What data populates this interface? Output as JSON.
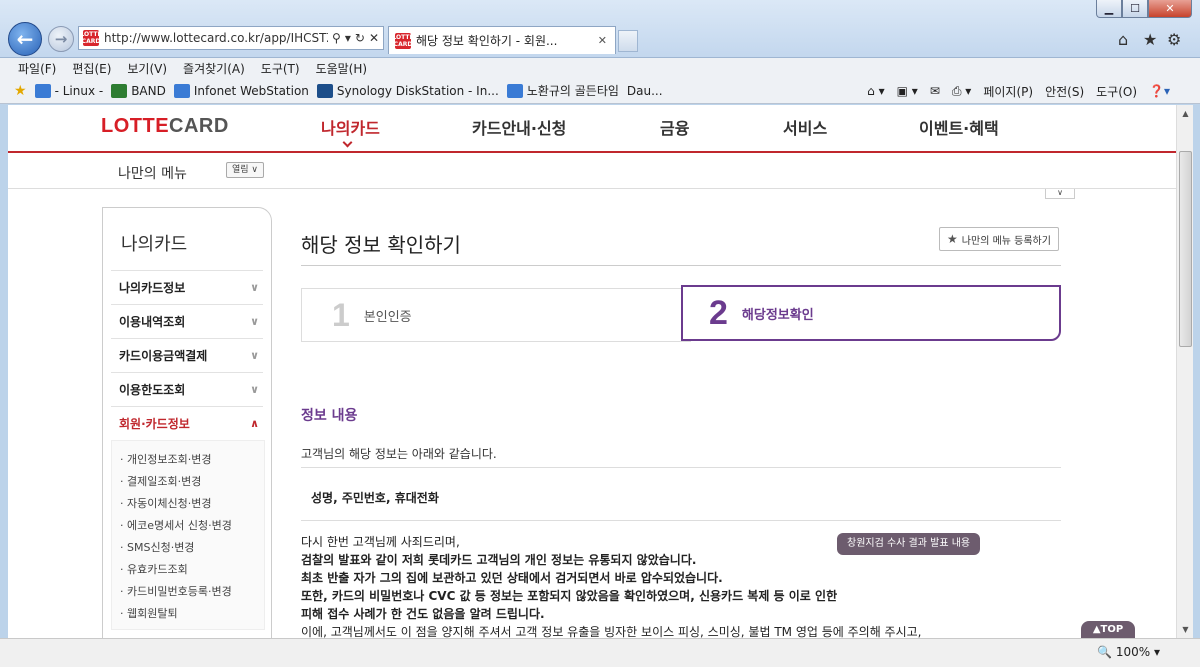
{
  "browser": {
    "address_url": "http://www.lottecard.co.kr/app/IHCSTZ",
    "tab_title": "해당 정보 확인하기 - 회원...",
    "favicon_text": "LOTTE CARD",
    "menus": [
      "파일(F)",
      "편집(E)",
      "보기(V)",
      "즐겨찾기(A)",
      "도구(T)",
      "도움말(H)"
    ],
    "favorites": [
      "- Linux -",
      "BAND",
      "Infonet WebStation",
      "Synology DiskStation - In...",
      "노환규의 골든타임",
      "Dau..."
    ],
    "commands": [
      "페이지(P)",
      "안전(S)",
      "도구(O)"
    ],
    "zoom": "100%"
  },
  "site": {
    "logo_red": "LOTTE",
    "logo_gray": "CARD",
    "gnb": [
      "나의카드",
      "카드안내·신청",
      "금융",
      "서비스",
      "이벤트·혜택"
    ],
    "my_menu": "나만의 메뉴",
    "open_btn": "열림 ∨"
  },
  "lnb": {
    "title": "나의카드",
    "items": [
      "나의카드정보",
      "이용내역조회",
      "카드이용금액결제",
      "이용한도조회",
      "회원·카드정보"
    ],
    "subitems": [
      "개인정보조회·변경",
      "결제일조회·변경",
      "자동이체신청·변경",
      "에코e명세서 신청·변경",
      "SMS신청·변경",
      "유효카드조회",
      "카드비밀번호등록·변경",
      "웹회원탈퇴"
    ]
  },
  "content": {
    "page_title": "해당 정보 확인하기",
    "my_menu_btn": "나만의 메뉴 등록하기",
    "step1_num": "1",
    "step1_label": "본인인증",
    "step2_num": "2",
    "step2_label": "해당정보확인",
    "section_title": "정보 내용",
    "intro": "고객님의 해당 정보는 아래와 같습니다.",
    "info_items": "성명, 주민번호, 휴대전화",
    "notice_lines": [
      "다시 한번 고객님께 사죄드리며,",
      "검찰의 발표와 같이 저희 롯데카드 고객님의 개인 정보는 유통되지 않았습니다.",
      "최초 반출 자가 그의 집에 보관하고 있던 상태에서 검거되면서 바로 압수되었습니다.",
      "또한, 카드의 비밀번호나 CVC 값 등 정보는 포함되지 않았음을 확인하였으며, 신용카드 복제 등 이로 인한",
      "피해 접수 사례가 한 건도 없음을 알려 드립니다.",
      "이에, 고객님께서도 이 점을 양지해 주셔서 고객 정보 유출을 빙자한 보이스 피싱, 스미싱, 불법 TM 영업 등에 주의해 주시고,"
    ],
    "pill": "창원지검 수사 결과 발표 내용",
    "top_btn": "▲TOP"
  },
  "colors": {
    "brand_red": "#c0272d",
    "purple": "#6b3b8e"
  }
}
